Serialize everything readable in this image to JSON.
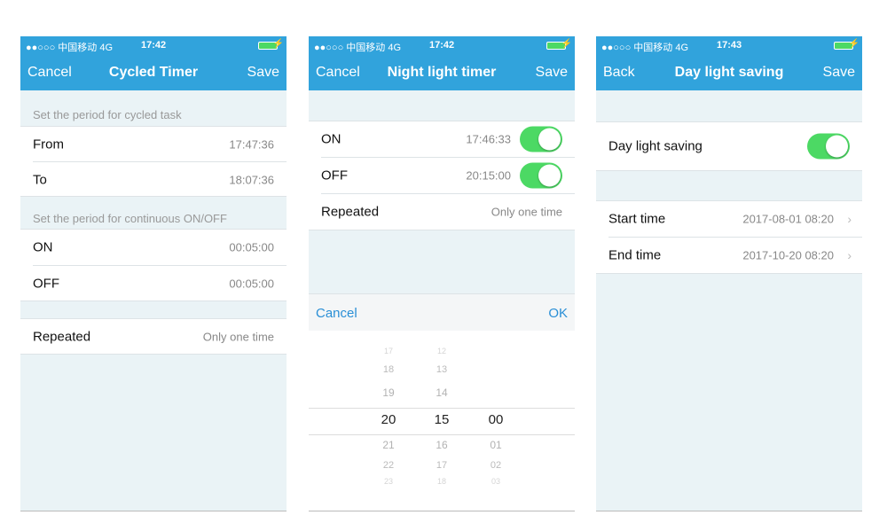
{
  "status": {
    "carrier": "●●○○○ 中国移动  4G"
  },
  "screen1": {
    "time": "17:42",
    "nav": {
      "left": "Cancel",
      "title": "Cycled Timer",
      "right": "Save"
    },
    "header1": "Set the period for cycled task",
    "from": {
      "label": "From",
      "value": "17:47:36"
    },
    "to": {
      "label": "To",
      "value": "18:07:36"
    },
    "header2": "Set the period for continuous ON/OFF",
    "on": {
      "label": "ON",
      "value": "00:05:00"
    },
    "off": {
      "label": "OFF",
      "value": "00:05:00"
    },
    "repeated": {
      "label": "Repeated",
      "value": "Only one time"
    }
  },
  "screen2": {
    "time": "17:42",
    "nav": {
      "left": "Cancel",
      "title": "Night light timer",
      "right": "Save"
    },
    "on": {
      "label": "ON",
      "value": "17:46:33",
      "enabled": true
    },
    "off": {
      "label": "OFF",
      "value": "20:15:00",
      "enabled": true
    },
    "repeated": {
      "label": "Repeated",
      "value": "Only one time"
    },
    "picker": {
      "cancel": "Cancel",
      "ok": "OK",
      "hours": [
        "17",
        "18",
        "19",
        "20",
        "21",
        "22",
        "23"
      ],
      "minutes": [
        "12",
        "13",
        "14",
        "15",
        "16",
        "17",
        "18"
      ],
      "seconds": [
        "00",
        "01",
        "02",
        "03"
      ],
      "selected": {
        "hour": "20",
        "minute": "15",
        "second": "00"
      }
    }
  },
  "screen3": {
    "time": "17:43",
    "nav": {
      "left": "Back",
      "title": "Day light saving",
      "right": "Save"
    },
    "dls": {
      "label": "Day light saving",
      "enabled": true
    },
    "start": {
      "label": "Start time",
      "value": "2017-08-01 08:20"
    },
    "end": {
      "label": "End time",
      "value": "2017-10-20 08:20"
    }
  },
  "colors": {
    "nav": "#31a3dc",
    "toggle_on": "#4cd964",
    "link": "#2a8fd6",
    "background": "#eaf3f6"
  }
}
